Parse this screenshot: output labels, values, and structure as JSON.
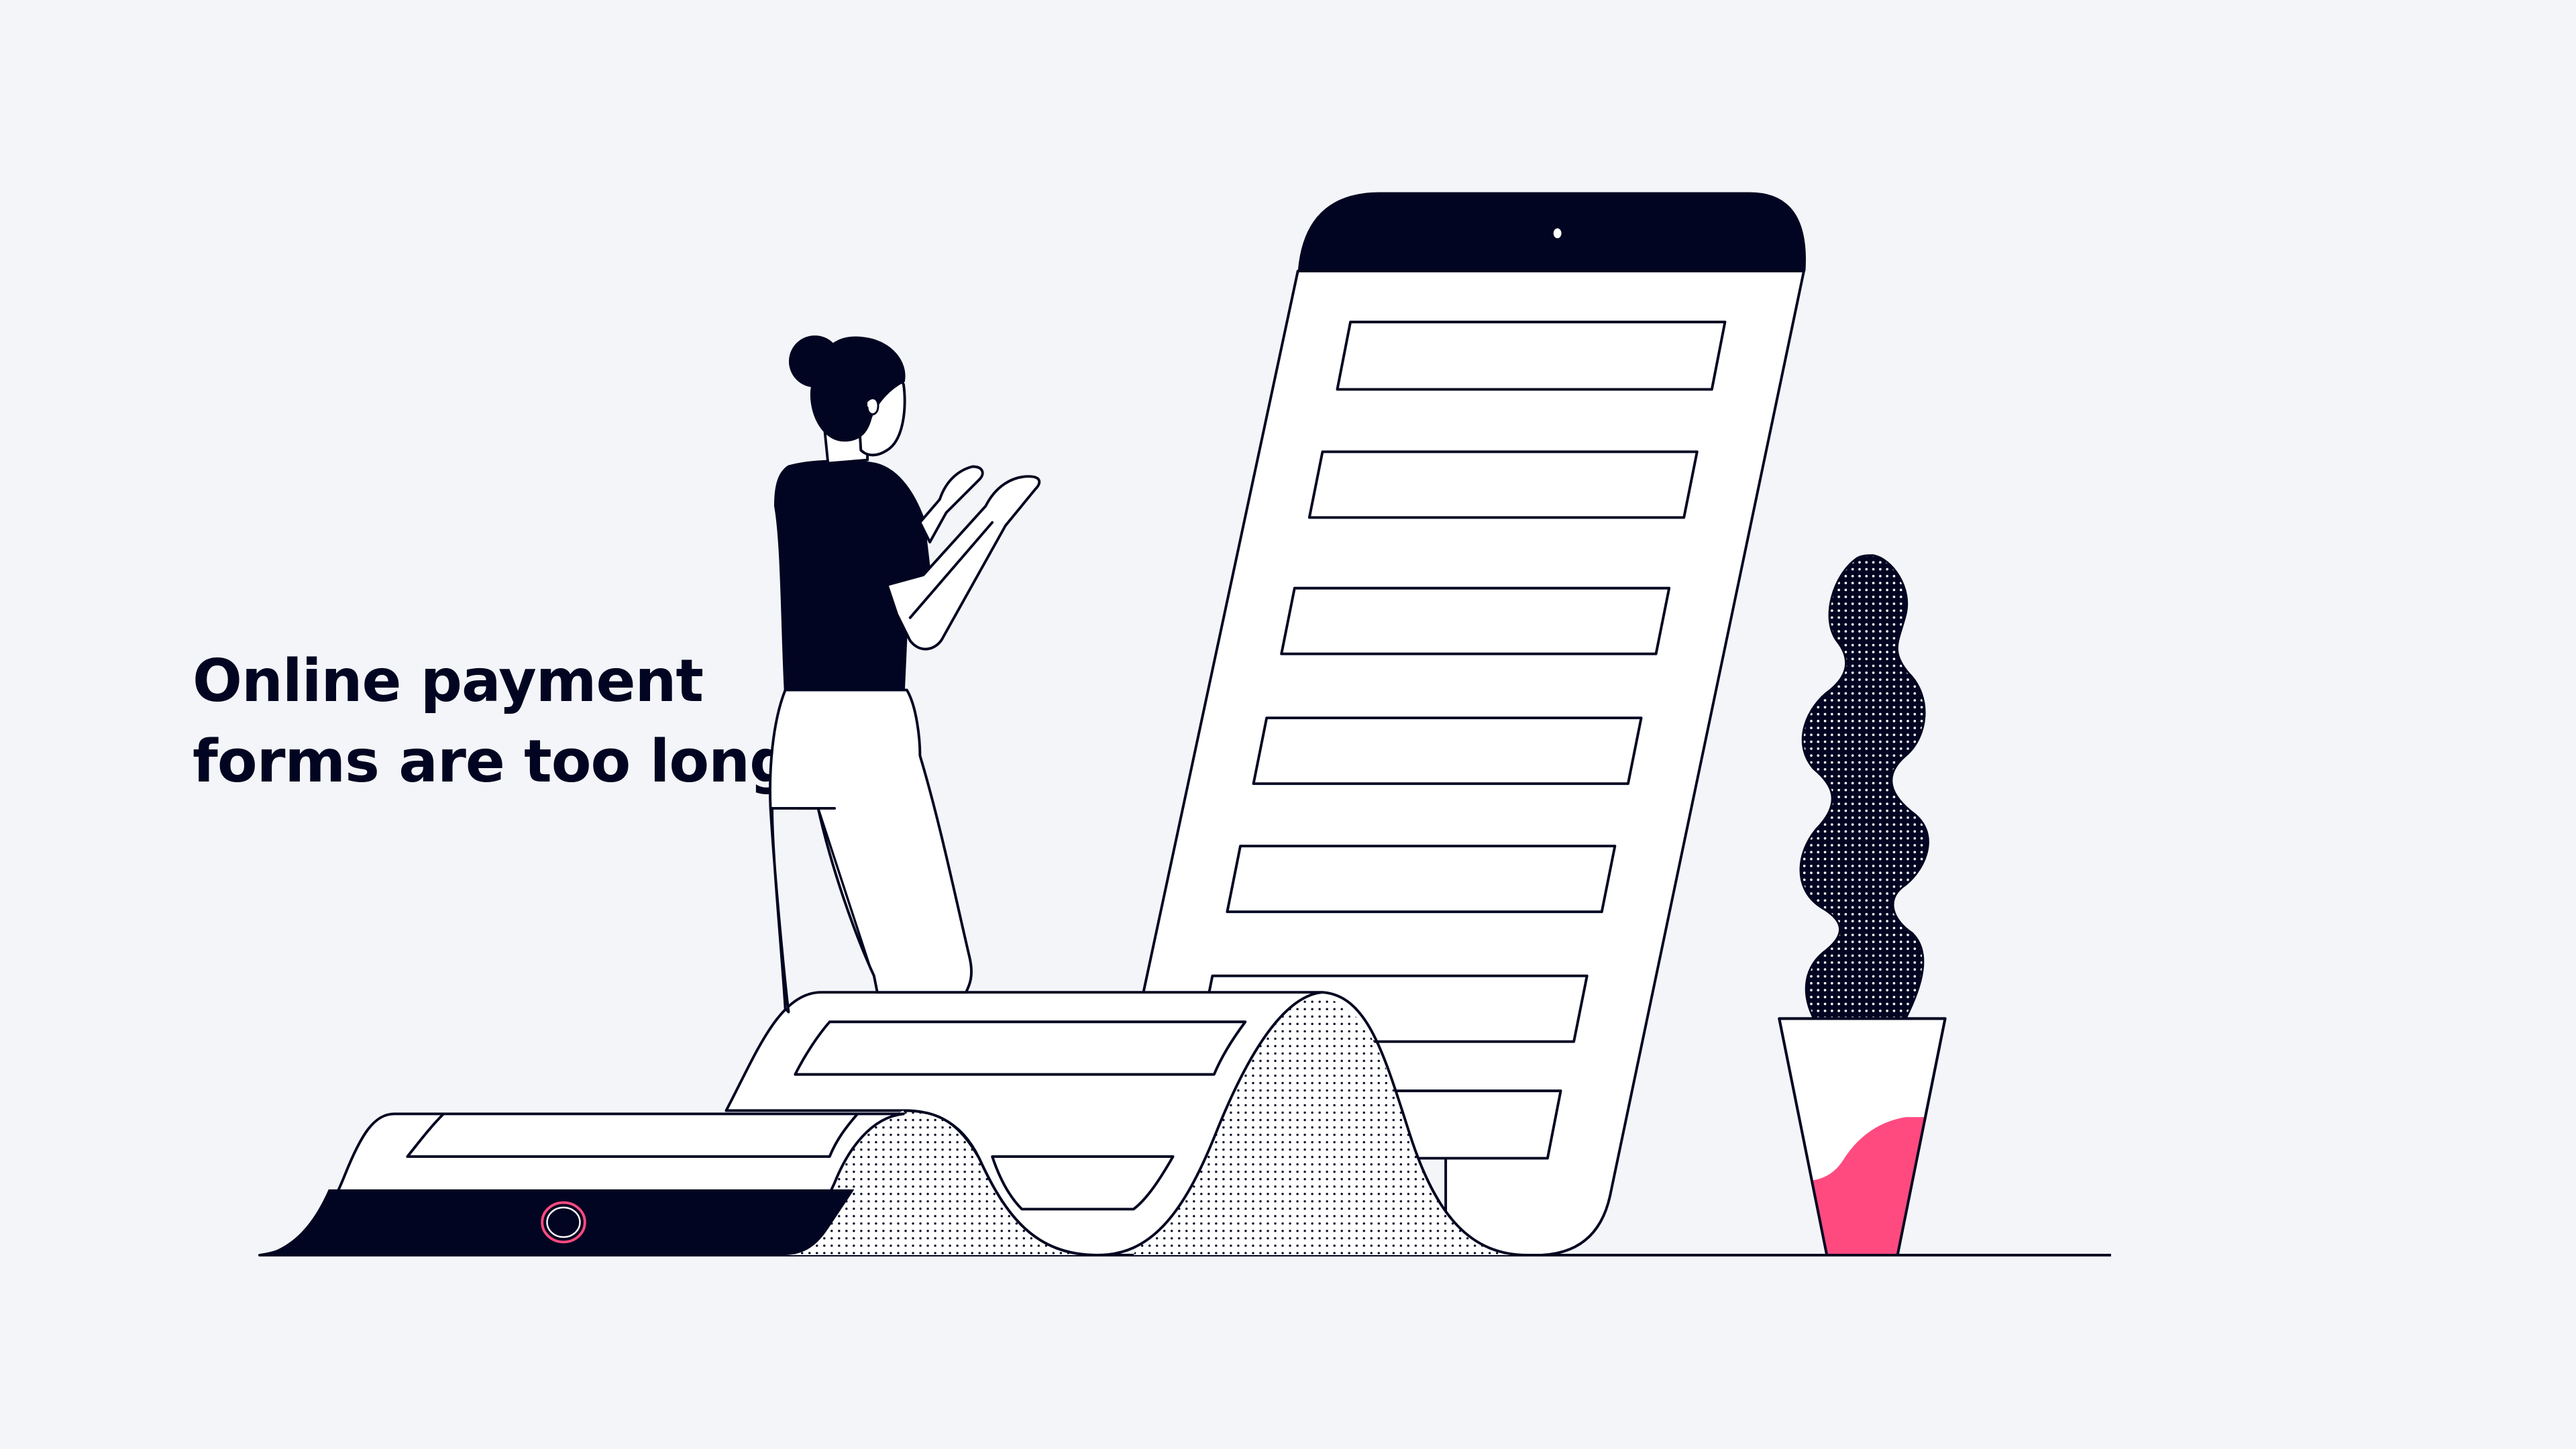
{
  "headline": {
    "line1": "Online payment",
    "line2": "forms are too long"
  },
  "colors": {
    "background": "#f4f5f9",
    "ink": "#020521",
    "paper": "#ffffff",
    "accent": "#ff4a80"
  },
  "illustration": {
    "subject": "person-looking-at-long-payment-form",
    "phone_form_fields_visible": 7,
    "unrolled_paper_fields_visible": 3,
    "icons": [
      "person",
      "phone",
      "paper-roll",
      "plant-pot",
      "camera-dot",
      "home-button"
    ]
  }
}
